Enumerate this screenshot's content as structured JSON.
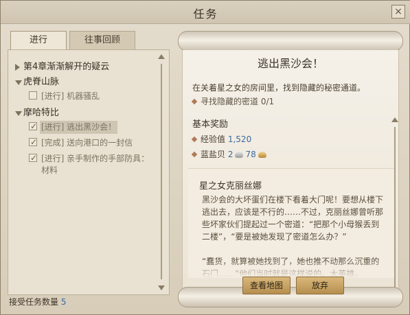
{
  "window": {
    "title": "任务",
    "close": "×"
  },
  "tabs": [
    "进行",
    "往事回顾"
  ],
  "quest_list": [
    {
      "type": "chapter",
      "label": "第4章渐渐解开的疑云",
      "expanded": false
    },
    {
      "type": "region",
      "label": "虎脊山脉",
      "expanded": true,
      "quests": [
        {
          "label": "[进行] 机器骚乱",
          "checked": false
        }
      ]
    },
    {
      "type": "region",
      "label": "摩哈特比",
      "expanded": true,
      "quests": [
        {
          "label": "[进行] 逃出黑沙会！",
          "checked": true,
          "selected": true
        },
        {
          "label": "[完成] 送向港口的一封信",
          "checked": true
        },
        {
          "label": "[进行] 亲手制作的手部防具：材料",
          "checked": true
        }
      ]
    }
  ],
  "footer": {
    "label": "接受任务数量",
    "count": "5"
  },
  "detail": {
    "title": "逃出黑沙会！",
    "description": "在关着星之女的房间里，找到隐藏的秘密通道。",
    "objective": "寻找隐藏的密道 0/1",
    "rewards_header": "基本奖励",
    "reward_exp_label": "经验值",
    "reward_exp_value": "1,520",
    "reward_money_label": "蓝盐贝",
    "reward_money_silver": "2",
    "reward_money_gold": "78",
    "npc_name": "星之女克丽丝娜",
    "npc_dialogue": "黑沙会的大坏蛋们在楼下看着大门呢！要想从楼下逃出去，应该是不行的……不过，克丽丝娜曾听那些坏家伙们提起过一个密道：“把那个小母猴丢到二楼”，“要是被她发现了密道怎么办？”\n\n“蠢货，就算被她找到了，她也推不动那么沉重的石门……”他们当时就是这样说的。大英雄，"
  },
  "buttons": {
    "view_map": "查看地图",
    "abandon": "放弃"
  }
}
